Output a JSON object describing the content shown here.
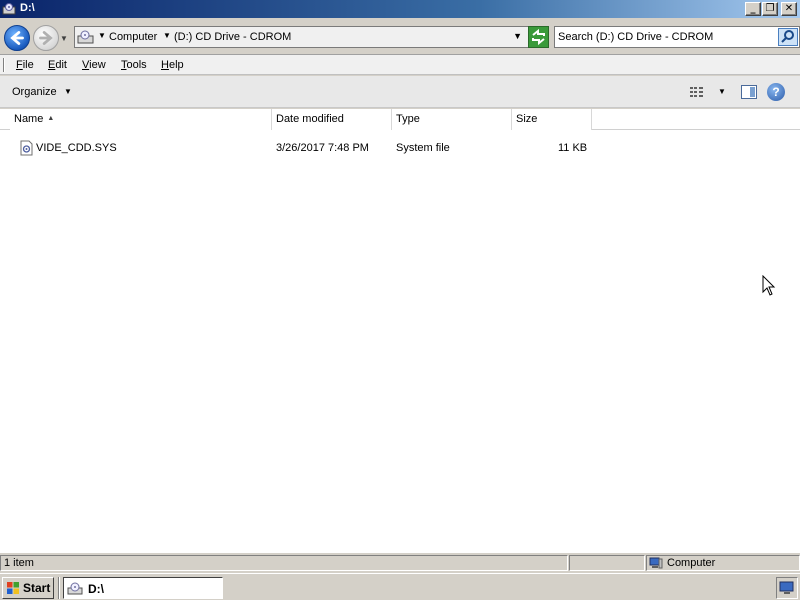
{
  "window": {
    "title": "D:\\",
    "minimize_glyph": "_",
    "maximize_glyph": "❐",
    "close_glyph": "✕"
  },
  "address": {
    "crumbs": [
      "Computer",
      "(D:) CD Drive - CDROM"
    ],
    "search_placeholder": "Search (D:) CD Drive - CDROM"
  },
  "menu": {
    "items": [
      {
        "underline": "F",
        "rest": "ile"
      },
      {
        "underline": "E",
        "rest": "dit"
      },
      {
        "underline": "V",
        "rest": "iew"
      },
      {
        "underline": "T",
        "rest": "ools"
      },
      {
        "underline": "H",
        "rest": "elp"
      }
    ]
  },
  "commands": {
    "organize_label": "Organize",
    "help_glyph": "?"
  },
  "columns": [
    "Name",
    "Date modified",
    "Type",
    "Size"
  ],
  "files": [
    {
      "name": "VIDE_CDD.SYS",
      "date_modified": "3/26/2017 7:48 PM",
      "type": "System file",
      "size": "11 KB"
    }
  ],
  "status": {
    "item_count": "1 item",
    "location": "Computer"
  },
  "taskbar": {
    "start_label": "Start",
    "active_window_label": "D:\\"
  },
  "icons": {
    "back": "back-arrow-icon",
    "forward": "forward-arrow-icon",
    "drive": "cd-drive-icon",
    "refresh": "refresh-icon",
    "search": "magnifier-icon",
    "file": "system-file-icon",
    "computer": "computer-icon",
    "start": "windows-logo-icon"
  },
  "colors": {
    "title_bar_start": "#0a246a",
    "title_bar_end": "#a6caf0",
    "back_button": "#1a5bbf",
    "refresh_button": "#3a9a3a"
  }
}
